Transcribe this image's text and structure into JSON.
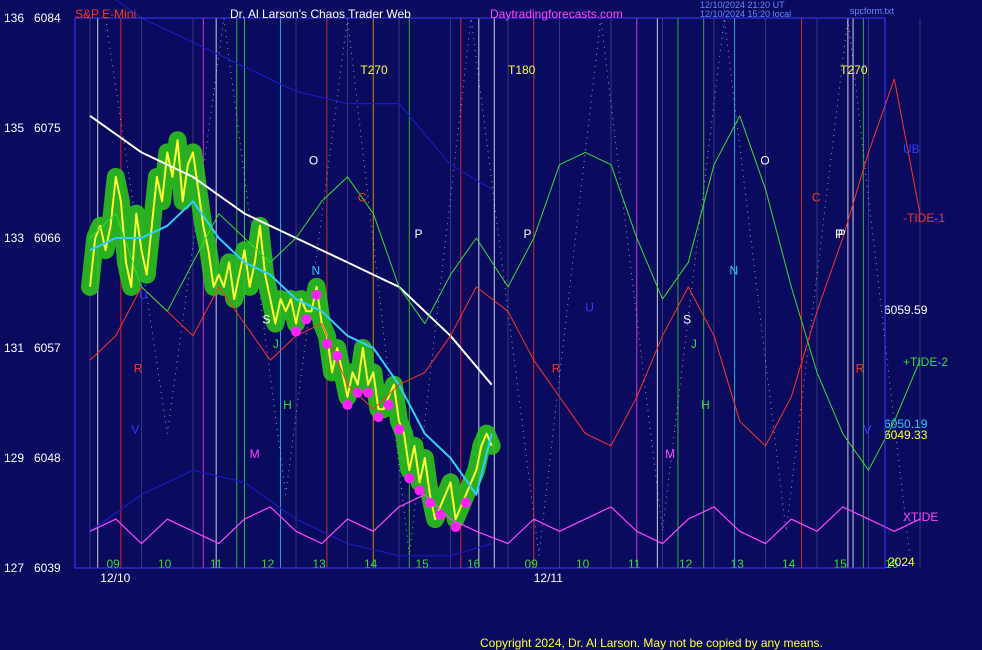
{
  "header": {
    "symbol": "S&P E-Mini",
    "title": "Dr. Al Larson's Chaos Trader Web",
    "site": "Daytradingforecasts.com",
    "timestamp_line1": "12/10/2024 21:20 UT",
    "timestamp_line2": "12/10/2024 15:20 local",
    "file": "spcform.txt"
  },
  "footer": {
    "copyright": "Copyright 2024, Dr. Al Larson. May not be copied by any means."
  },
  "colors": {
    "background": "#0a0a5e",
    "frame": "#3a3aff",
    "price": "#ffff33",
    "price_glow": "#2cc21c",
    "moving_average": "#ffffff",
    "fast_average": "#33ccff",
    "tide1": "#ff3322",
    "tide2": "#33dd33",
    "xtide": "#ff44ff",
    "band": "#1a1ac0",
    "dots": "#ff22ff"
  },
  "chart_data": {
    "type": "line",
    "y_left_ticks": [
      {
        "a": "136",
        "b": "6084",
        "v": 6084
      },
      {
        "a": "135",
        "b": "6075",
        "v": 6075
      },
      {
        "a": "133",
        "b": "6066",
        "v": 6066
      },
      {
        "a": "131",
        "b": "6057",
        "v": 6057
      },
      {
        "a": "129",
        "b": "6048",
        "v": 6048
      },
      {
        "a": "127",
        "b": "6039",
        "v": 6039
      }
    ],
    "ylim": [
      6039,
      6084
    ],
    "x_hours": [
      "09",
      "10",
      "11",
      "12",
      "13",
      "14",
      "15",
      "16",
      "09",
      "10",
      "11",
      "12",
      "13",
      "14",
      "15",
      "16"
    ],
    "x_dates": [
      "12/10",
      "12/11"
    ],
    "x_year": "2024",
    "right_labels": [
      {
        "text": "UB",
        "color": "#3a3aff"
      },
      {
        "text": "-TIDE-1",
        "color": "#ff3322"
      },
      {
        "text": "6059.59",
        "color": "#ffffff"
      },
      {
        "text": "+TIDE-2",
        "color": "#33dd33"
      },
      {
        "text": "6050.19",
        "color": "#33ccff"
      },
      {
        "text": "6049.33",
        "color": "#ffff33"
      },
      {
        "text": "XTIDE",
        "color": "#ff44ff"
      }
    ],
    "top_markers": [
      "T270",
      "T180",
      "T270"
    ],
    "planet_labels": [
      {
        "text": "O",
        "color": "#ffffff"
      },
      {
        "text": "C",
        "color": "#ff3322"
      },
      {
        "text": "P",
        "color": "#ffffff"
      },
      {
        "text": "P",
        "color": "#ffffff"
      },
      {
        "text": "P",
        "color": "#ffffff"
      },
      {
        "text": "U",
        "color": "#3a3aff"
      },
      {
        "text": "R",
        "color": "#ff3322"
      },
      {
        "text": "R",
        "color": "#ff3322"
      },
      {
        "text": "R",
        "color": "#ff3322"
      },
      {
        "text": "S",
        "color": "#ffffff"
      },
      {
        "text": "S",
        "color": "#ffffff"
      },
      {
        "text": "N",
        "color": "#33ccff"
      },
      {
        "text": "N",
        "color": "#33ccff"
      },
      {
        "text": "J",
        "color": "#33dd33"
      },
      {
        "text": "J",
        "color": "#33dd33"
      },
      {
        "text": "H",
        "color": "#33dd33"
      },
      {
        "text": "H",
        "color": "#33dd33"
      },
      {
        "text": "M",
        "color": "#ff44ff"
      },
      {
        "text": "M",
        "color": "#ff44ff"
      },
      {
        "text": "O",
        "color": "#ffffff"
      },
      {
        "text": "C",
        "color": "#ff3322"
      },
      {
        "text": "P",
        "color": "#ffffff"
      },
      {
        "text": "V",
        "color": "#3a3aff"
      },
      {
        "text": "V",
        "color": "#3a3aff"
      },
      {
        "text": "U",
        "color": "#3a3aff"
      }
    ],
    "series": [
      {
        "name": "S&P E-Mini price",
        "x": [
          0,
          0.1,
          0.2,
          0.3,
          0.4,
          0.5,
          0.6,
          0.7,
          0.8,
          0.9,
          1.0,
          1.1,
          1.2,
          1.3,
          1.4,
          1.5,
          1.6,
          1.7,
          1.8,
          1.9,
          2.0,
          2.1,
          2.2,
          2.3,
          2.4,
          2.5,
          2.6,
          2.7,
          2.8,
          2.9,
          3.0,
          3.1,
          3.2,
          3.3,
          3.4,
          3.5,
          3.6,
          3.7,
          3.8,
          3.9,
          4.0,
          4.1,
          4.2,
          4.3,
          4.4,
          4.5,
          4.6,
          4.7,
          4.8,
          4.9,
          5.0,
          5.1,
          5.2,
          5.3,
          5.4,
          5.5,
          5.6,
          5.7,
          5.8,
          5.9,
          6.0,
          6.1,
          6.2,
          6.3,
          6.4,
          6.5,
          6.6,
          6.7,
          6.8,
          7.0,
          7.1,
          7.2,
          7.3,
          7.4,
          7.5,
          7.6,
          7.7,
          7.8
        ],
        "values": [
          6062,
          6066,
          6067,
          6065,
          6067,
          6071,
          6069,
          6064,
          6062,
          6068,
          6065,
          6063,
          6067,
          6071,
          6069,
          6073,
          6071,
          6074,
          6069,
          6072,
          6073,
          6070,
          6067,
          6065,
          6062,
          6063,
          6062,
          6064,
          6061,
          6063,
          6065,
          6062,
          6064,
          6067,
          6063,
          6061,
          6059,
          6061,
          6060,
          6061,
          6059,
          6061,
          6060,
          6060,
          6062,
          6059,
          6058,
          6055,
          6057,
          6055,
          6053,
          6055,
          6054,
          6057,
          6054,
          6055,
          6052,
          6052,
          6053,
          6054,
          6051,
          6050,
          6047,
          6049,
          6046,
          6048,
          6045,
          6043,
          6044,
          6046,
          6043,
          6044,
          6045,
          6046,
          6047,
          6049,
          6050,
          6049
        ]
      },
      {
        "name": "slow average",
        "x": [
          0,
          1,
          2,
          3,
          4,
          5,
          6,
          7,
          7.8
        ],
        "values": [
          6076,
          6073,
          6071,
          6068,
          6066,
          6064,
          6062,
          6058,
          6054
        ]
      },
      {
        "name": "fast average",
        "x": [
          0,
          0.5,
          1,
          1.5,
          2,
          2.5,
          3,
          3.5,
          4,
          4.5,
          5,
          5.5,
          6,
          6.5,
          7,
          7.5,
          7.8
        ],
        "values": [
          6065,
          6066,
          6066,
          6067,
          6069,
          6066,
          6064,
          6063,
          6061,
          6060,
          6058,
          6057,
          6054,
          6050,
          6048,
          6045,
          6050
        ]
      },
      {
        "name": "-TIDE-1",
        "x": [
          0,
          0.5,
          1,
          1.5,
          2,
          2.5,
          3,
          3.5,
          4,
          4.5,
          5,
          5.5,
          6,
          6.5,
          7,
          7.5,
          8,
          8.5,
          9,
          9.5,
          10,
          10.5,
          11,
          11.5,
          12,
          12.5,
          13,
          13.5,
          14,
          14.5,
          15,
          15.5,
          16
        ],
        "values": [
          6056,
          6058,
          6062,
          6060,
          6058,
          6062,
          6059,
          6056,
          6058,
          6059,
          6054,
          6052,
          6054,
          6055,
          6058,
          6062,
          6060,
          6056,
          6053,
          6050,
          6049,
          6053,
          6058,
          6062,
          6058,
          6051,
          6049,
          6053,
          6060,
          6066,
          6073,
          6079,
          6068
        ]
      },
      {
        "name": "+TIDE-2",
        "x": [
          0,
          0.5,
          1,
          1.5,
          2,
          2.5,
          3,
          3.5,
          4,
          4.5,
          5,
          5.5,
          6,
          6.5,
          7,
          7.5,
          8,
          8.5,
          9,
          9.5,
          10,
          10.5,
          11,
          11.5,
          12,
          12.5,
          13,
          13.5,
          14,
          14.5,
          15,
          15.5,
          16
        ],
        "values": [
          6066,
          6068,
          6062,
          6060,
          6064,
          6068,
          6066,
          6064,
          6066,
          6069,
          6071,
          6068,
          6062,
          6059,
          6063,
          6066,
          6062,
          6066,
          6072,
          6073,
          6072,
          6066,
          6061,
          6064,
          6072,
          6076,
          6070,
          6062,
          6055,
          6050,
          6047,
          6051,
          6056
        ]
      },
      {
        "name": "XTIDE",
        "x": [
          0,
          0.5,
          1,
          1.5,
          2,
          2.5,
          3,
          3.5,
          4,
          4.5,
          5,
          5.5,
          6,
          6.5,
          7,
          7.5,
          8,
          8.5,
          9,
          9.5,
          10,
          10.5,
          11,
          11.5,
          12,
          12.5,
          13,
          13.5,
          14,
          14.5,
          15,
          15.5,
          16
        ],
        "values": [
          6042,
          6043,
          6041,
          6043,
          6042,
          6041,
          6043,
          6044,
          6042,
          6041,
          6043,
          6042,
          6044,
          6045,
          6043,
          6042,
          6041,
          6043,
          6042,
          6043,
          6044,
          6042,
          6041,
          6043,
          6044,
          6042,
          6041,
          6043,
          6042,
          6044,
          6043,
          6042,
          6043
        ]
      }
    ]
  }
}
